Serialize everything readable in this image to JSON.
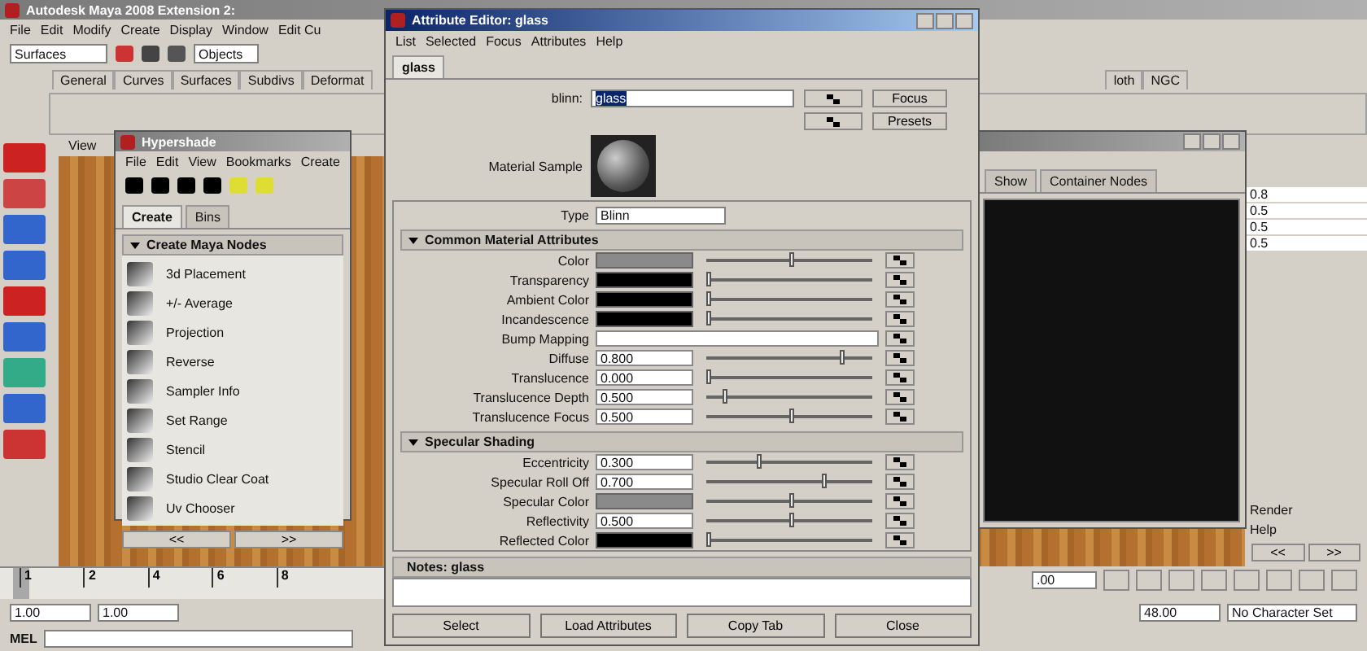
{
  "main_window": {
    "title": "Autodesk Maya 2008 Extension 2:",
    "menu": [
      "File",
      "Edit",
      "Modify",
      "Create",
      "Display",
      "Window",
      "Edit Cu"
    ],
    "menu_set": "Surfaces",
    "selection_field": "Objects",
    "shelf_tabs": [
      "General",
      "Curves",
      "Surfaces",
      "Subdivs",
      "Deformat"
    ],
    "shelf_tabs_right": [
      "loth",
      "NGC"
    ],
    "panel_menu": "View"
  },
  "hypershade": {
    "title": "Hypershade",
    "menu": [
      "File",
      "Edit",
      "View",
      "Bookmarks",
      "Create"
    ],
    "tabs": [
      {
        "label": "Create",
        "selected": true
      },
      {
        "label": "Bins",
        "selected": false
      }
    ],
    "section": "Create Maya Nodes",
    "nodes": [
      "3d Placement",
      "+/- Average",
      "Projection",
      "Reverse",
      "Sampler Info",
      "Set Range",
      "Stencil",
      "Studio Clear Coat",
      "Uv Chooser"
    ],
    "nav": [
      "<<",
      ">>"
    ],
    "work_tabs": [
      "Show",
      "Container Nodes"
    ]
  },
  "side_panel": {
    "values": [
      "0.8",
      "0.5",
      "0.5",
      "0.5"
    ],
    "menu": [
      "Render",
      "Help"
    ],
    "nav": [
      "<<",
      ">>"
    ]
  },
  "timeline": {
    "level": 0,
    "ticks": [
      "1",
      "2",
      "4",
      "6",
      "8"
    ],
    "current_time": ".00",
    "start": "1.00",
    "range_start": "1.00",
    "range_end": "48.00",
    "character_set": "No Character Set",
    "command_label": "MEL"
  },
  "attribute_editor": {
    "title": "Attribute Editor: glass",
    "menu": [
      "List",
      "Selected",
      "Focus",
      "Attributes",
      "Help"
    ],
    "tabs": [
      {
        "label": "glass",
        "selected": true
      }
    ],
    "node_type": "blinn:",
    "node_name": "glass",
    "buttons_top": [
      "Focus",
      "Presets"
    ],
    "sample_label": "Material Sample",
    "type_label": "Type",
    "type_value": "Blinn",
    "sections": [
      {
        "title": "Common Material Attributes",
        "expanded": true,
        "rows": [
          {
            "label": "Color",
            "kind": "color",
            "color": "#8a8a8a",
            "level": 0.5
          },
          {
            "label": "Transparency",
            "kind": "color",
            "color": "#000000",
            "level": 0
          },
          {
            "label": "Ambient Color",
            "kind": "color",
            "color": "#000000",
            "level": 0
          },
          {
            "label": "Incandescence",
            "kind": "color",
            "color": "#000000",
            "level": 0
          },
          {
            "label": "Bump Mapping",
            "kind": "map"
          },
          {
            "label": "Diffuse",
            "kind": "number",
            "value": "0.800",
            "level": 0.8
          },
          {
            "label": "Translucence",
            "kind": "number",
            "value": "0.000",
            "level": 0
          },
          {
            "label": "Translucence Depth",
            "kind": "number",
            "value": "0.500",
            "level": 0.1
          },
          {
            "label": "Translucence Focus",
            "kind": "number",
            "value": "0.500",
            "level": 0.5
          }
        ]
      },
      {
        "title": "Specular Shading",
        "expanded": true,
        "rows": [
          {
            "label": "Eccentricity",
            "kind": "number",
            "value": "0.300",
            "level": 0.3
          },
          {
            "label": "Specular Roll Off",
            "kind": "number",
            "value": "0.700",
            "level": 0.7
          },
          {
            "label": "Specular Color",
            "kind": "color",
            "color": "#8a8a8a",
            "level": 0.5
          },
          {
            "label": "Reflectivity",
            "kind": "number",
            "value": "0.500",
            "level": 0.5
          },
          {
            "label": "Reflected Color",
            "kind": "color",
            "color": "#000000",
            "level": 0
          }
        ]
      }
    ],
    "notes_label": "Notes:  glass",
    "buttons": [
      "Select",
      "Load Attributes",
      "Copy Tab",
      "Close"
    ]
  }
}
